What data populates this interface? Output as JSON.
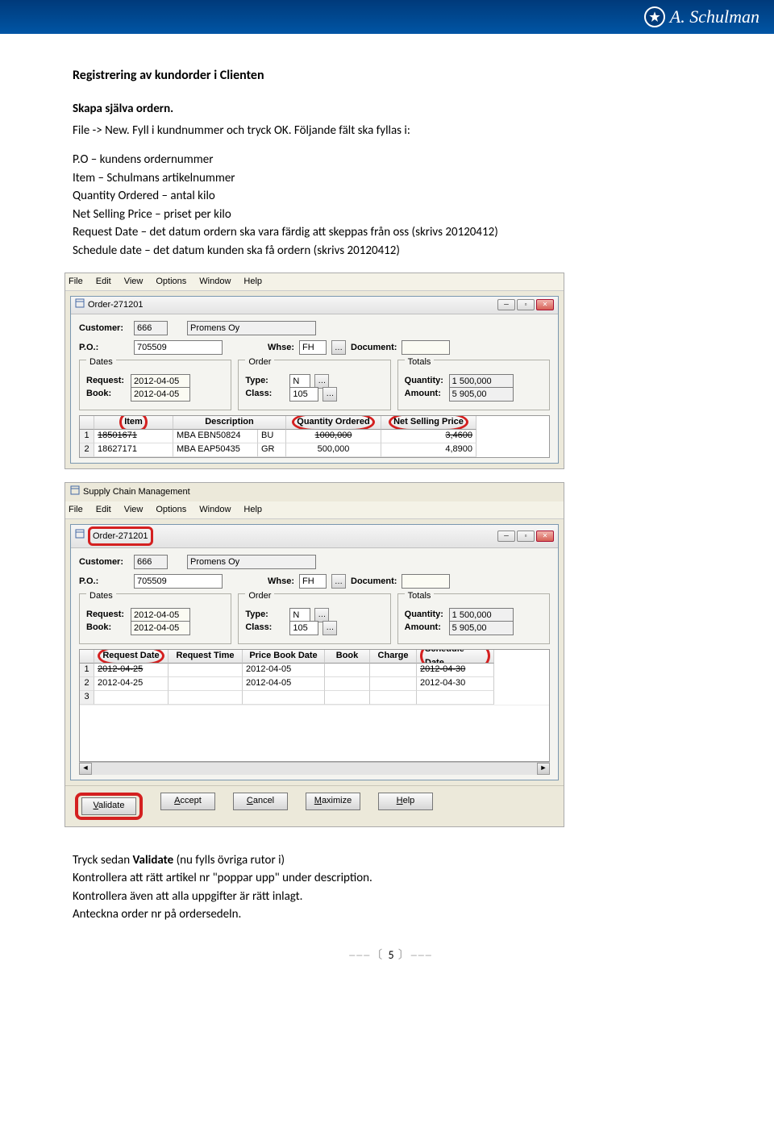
{
  "brand": "A. Schulman",
  "doc": {
    "title": "Registrering av kundorder i Clienten",
    "sub1": "Skapa själva ordern.",
    "line1": "File -> New. Fyll i kundnummer och tryck OK. Följande fält ska fyllas i:",
    "list1": "P.O – kundens ordernummer",
    "list2": "Item – Schulmans artikelnummer",
    "list3": "Quantity Ordered – antal kilo",
    "list4": "Net Selling Price – priset per kilo",
    "list5": "Request Date – det datum ordern ska vara färdig att skeppas från oss (skrivs 20120412)",
    "list6": "Schedule date – det datum kunden ska få ordern (skrivs 20120412)",
    "post1_a": "Tryck sedan ",
    "post1_b": "Validate",
    "post1_c": " (nu fylls övriga rutor i)",
    "post2": "Kontrollera att rätt artikel nr \"poppar upp\" under description.",
    "post3": "Kontrollera även att alla uppgifter är rätt inlagt.",
    "post4": "Anteckna order nr på ordersedeln.",
    "page_no": "5"
  },
  "menu": {
    "file": "File",
    "edit": "Edit",
    "view": "View",
    "options": "Options",
    "window": "Window",
    "help": "Help"
  },
  "win1": {
    "title": "Order-271201",
    "customer_lbl": "Customer:",
    "customer_id": "666",
    "customer_name": "Promens Oy",
    "po_lbl": "P.O.:",
    "po": "705509",
    "whse_lbl": "Whse:",
    "whse": "FH",
    "doc_lbl": "Document:",
    "doc": "",
    "dates_lbl": "Dates",
    "order_lbl": "Order",
    "totals_lbl": "Totals",
    "request_lbl": "Request:",
    "request": "2012-04-05",
    "book_lbl": "Book:",
    "book": "2012-04-05",
    "type_lbl": "Type:",
    "type": "N",
    "class_lbl": "Class:",
    "class": "105",
    "qty_lbl": "Quantity:",
    "qty": "1 500,000",
    "amt_lbl": "Amount:",
    "amt": "5 905,00",
    "cols": [
      "",
      "Item",
      "Description",
      "Quantity Ordered",
      "Net Selling Price"
    ],
    "rows": [
      {
        "n": "1",
        "item": "18501671",
        "desc_a": "MBA EBN50824",
        "desc_b": "BU",
        "qo": "1000,000",
        "nsp": "3,4600"
      },
      {
        "n": "2",
        "item": "18627171",
        "desc_a": "MBA EAP50435",
        "desc_b": "GR",
        "qo": "500,000",
        "nsp": "4,8900"
      }
    ]
  },
  "win2": {
    "scm": "Supply Chain Management",
    "title": "Order-271201",
    "customer_lbl": "Customer:",
    "customer_id": "666",
    "customer_name": "Promens Oy",
    "po_lbl": "P.O.:",
    "po": "705509",
    "whse_lbl": "Whse:",
    "whse": "FH",
    "doc_lbl": "Document:",
    "doc": "",
    "dates_lbl": "Dates",
    "order_lbl": "Order",
    "totals_lbl": "Totals",
    "request_lbl": "Request:",
    "request": "2012-04-05",
    "book_lbl": "Book:",
    "book": "2012-04-05",
    "type_lbl": "Type:",
    "type": "N",
    "class_lbl": "Class:",
    "class": "105",
    "qty_lbl": "Quantity:",
    "qty": "1 500,000",
    "amt_lbl": "Amount:",
    "amt": "5 905,00",
    "cols": [
      "",
      "Request Date",
      "Request Time",
      "Price Book Date",
      "Book",
      "Charge",
      "Schedule Date"
    ],
    "rows": [
      {
        "n": "1",
        "rd": "2012-04-25",
        "rt": "",
        "pbd": "2012-04-05",
        "bk": "",
        "ch": "",
        "sd": "2012-04-30"
      },
      {
        "n": "2",
        "rd": "2012-04-25",
        "rt": "",
        "pbd": "2012-04-05",
        "bk": "",
        "ch": "",
        "sd": "2012-04-30"
      },
      {
        "n": "3",
        "rd": "",
        "rt": "",
        "pbd": "",
        "bk": "",
        "ch": "",
        "sd": ""
      }
    ],
    "buttons": {
      "validate": "Validate",
      "accept": "Accept",
      "cancel": "Cancel",
      "maximize": "Maximize",
      "help": "Help"
    }
  }
}
